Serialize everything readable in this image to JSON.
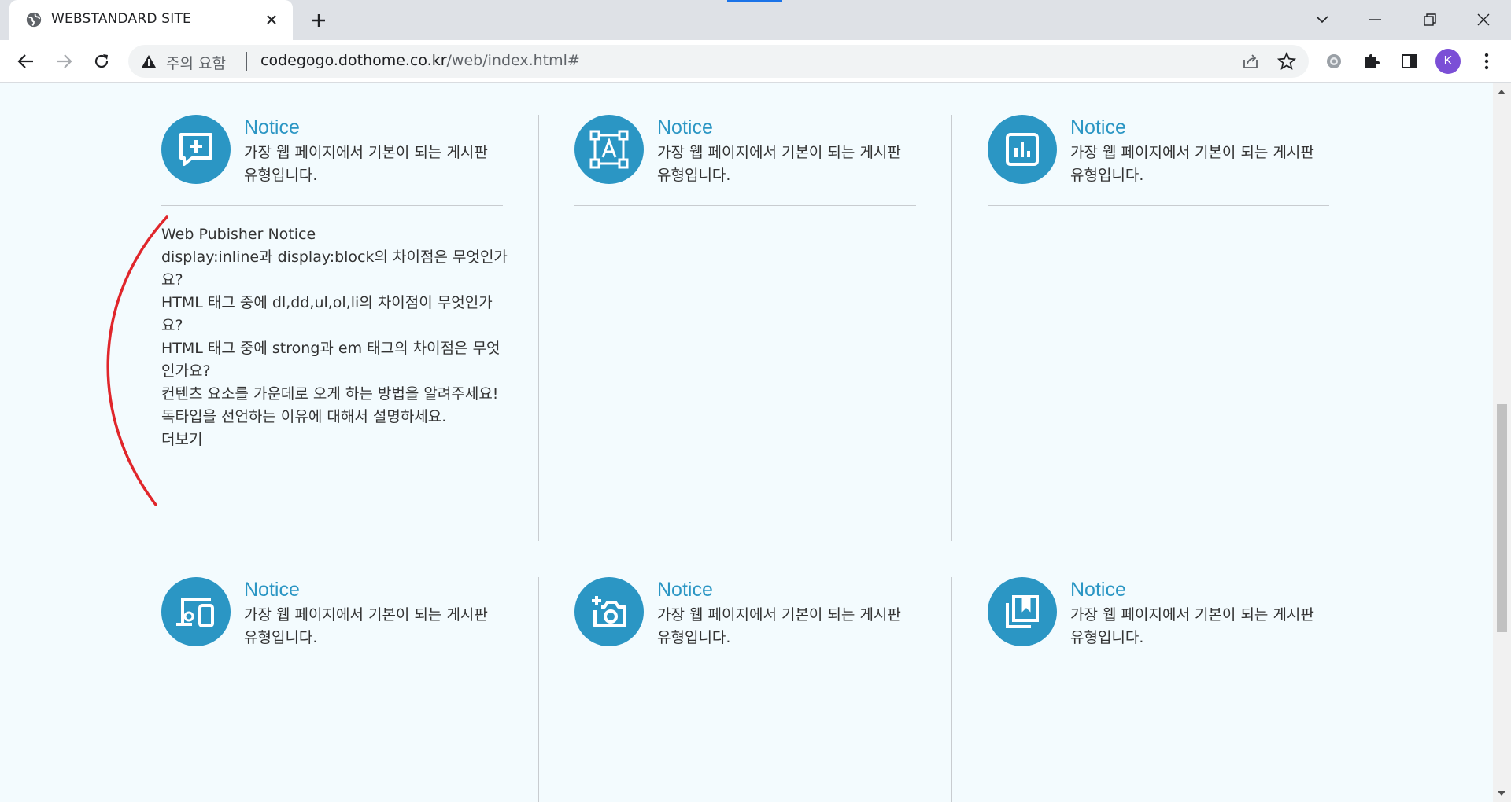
{
  "browser": {
    "tab_title": "WEBSTANDARD SITE",
    "security_label": "주의 요함",
    "url_host": "codegogo.dothome.co.kr",
    "url_path": "/web/index.html#",
    "avatar_letter": "K",
    "accent_color": "#1a73e8",
    "avatar_color": "#7b4fd6"
  },
  "page": {
    "brand_color": "#2b96c4",
    "cards": [
      {
        "title": "Notice",
        "description": "가장 웹 페이지에서 기본이 되는 게시판 유형입니다.",
        "icon": "add-comment-icon"
      },
      {
        "title": "Notice",
        "description": "가장 웹 페이지에서 기본이 되는 게시판 유형입니다.",
        "icon": "text-select-icon"
      },
      {
        "title": "Notice",
        "description": "가장 웹 페이지에서 기본이 되는 게시판 유형입니다.",
        "icon": "bar-chart-icon"
      },
      {
        "title": "Notice",
        "description": "가장 웹 페이지에서 기본이 되는 게시판 유형입니다.",
        "icon": "devices-icon"
      },
      {
        "title": "Notice",
        "description": "가장 웹 페이지에서 기본이 되는 게시판 유형입니다.",
        "icon": "add-camera-icon"
      },
      {
        "title": "Notice",
        "description": "가장 웹 페이지에서 기본이 되는 게시판 유형입니다.",
        "icon": "bookmarks-icon"
      }
    ],
    "notice_list": {
      "heading": "Web Pubisher Notice",
      "items": [
        "display:inline과 display:block의 차이점은 무엇인가요?",
        "HTML 태그 중에 dl,dd,ul,ol,li의 차이점이 무엇인가요?",
        "HTML 태그 중에 strong과 em 태그의 차이점은 무엇인가요?",
        "컨텐츠 요소를 가운데로 오게 하는 방법을 알려주세요!",
        "독타입을 선언하는 이유에 대해서 설명하세요."
      ],
      "more_label": "더보기"
    },
    "annotation_color": "#e0262b"
  }
}
